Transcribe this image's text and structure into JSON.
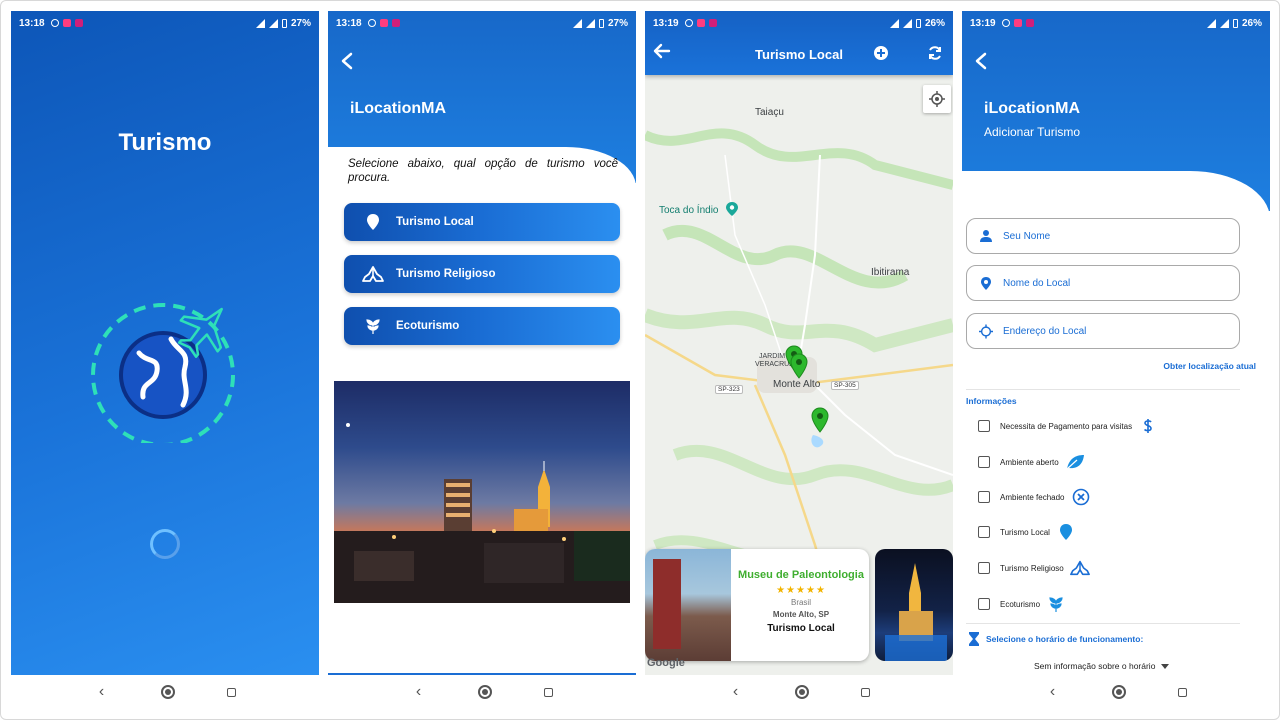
{
  "screens": [
    {
      "status": {
        "time": "13:18",
        "battery": "27%"
      },
      "title": "Turismo"
    },
    {
      "status": {
        "time": "13:18",
        "battery": "27%"
      },
      "app_name": "iLocationMA",
      "instruction": "Selecione abaixo, qual opção de turismo você procura.",
      "options": [
        {
          "label": "Turismo Local",
          "icon": "map-pin-icon"
        },
        {
          "label": "Turismo Religioso",
          "icon": "praying-hands-icon"
        },
        {
          "label": "Ecoturismo",
          "icon": "plant-icon"
        }
      ]
    },
    {
      "status": {
        "time": "13:19",
        "battery": "26%"
      },
      "title": "Turismo Local",
      "map_labels": {
        "taiacu": "Taiaçu",
        "toca": "Toca do Índio",
        "ibitirama": "Ibitirama",
        "jardim": "JARDIM",
        "veracruz": "VERACRUZ",
        "monte_alto": "Monte Alto",
        "sp323": "SP-323",
        "sp305": "SP-305",
        "google": "Google"
      },
      "card": {
        "name": "Museu de Paleontologia",
        "stars": 5,
        "country": "Brasil",
        "city": "Monte Alto, SP",
        "type": "Turismo Local"
      }
    },
    {
      "status": {
        "time": "13:19",
        "battery": "26%"
      },
      "app_name": "iLocationMA",
      "subtitle": "Adicionar Turismo",
      "fields": [
        {
          "placeholder": "Seu Nome",
          "icon": "person-icon"
        },
        {
          "placeholder": "Nome do Local",
          "icon": "map-pin-icon"
        },
        {
          "placeholder": "Endereço do Local",
          "icon": "crosshair-icon"
        }
      ],
      "location_link": "Obter localização atual",
      "info_title": "Informações",
      "checkboxes": [
        {
          "label": "Necessita de Pagamento para visitas",
          "icon": "dollar-icon",
          "checked": false
        },
        {
          "label": "Ambiente aberto",
          "icon": "leaf-icon",
          "checked": false
        },
        {
          "label": "Ambiente fechado",
          "icon": "close-circle-icon",
          "checked": false
        },
        {
          "label": "Turismo Local",
          "icon": "map-pin-icon",
          "checked": false
        },
        {
          "label": "Turismo Religioso",
          "icon": "praying-hands-icon",
          "checked": false
        },
        {
          "label": "Ecoturismo",
          "icon": "plant-icon",
          "checked": false
        }
      ],
      "hours_title": "Selecione o horário de funcionamento:",
      "hours_value": "Sem informação sobre o horário"
    }
  ],
  "colors": {
    "primary": "#1a6dd4",
    "primary_dark": "#0f4fae",
    "accent_teal": "#2ee0b8",
    "marker_green": "#2db82d",
    "card_title_green": "#3fae2f",
    "star_gold": "#f2b400"
  }
}
